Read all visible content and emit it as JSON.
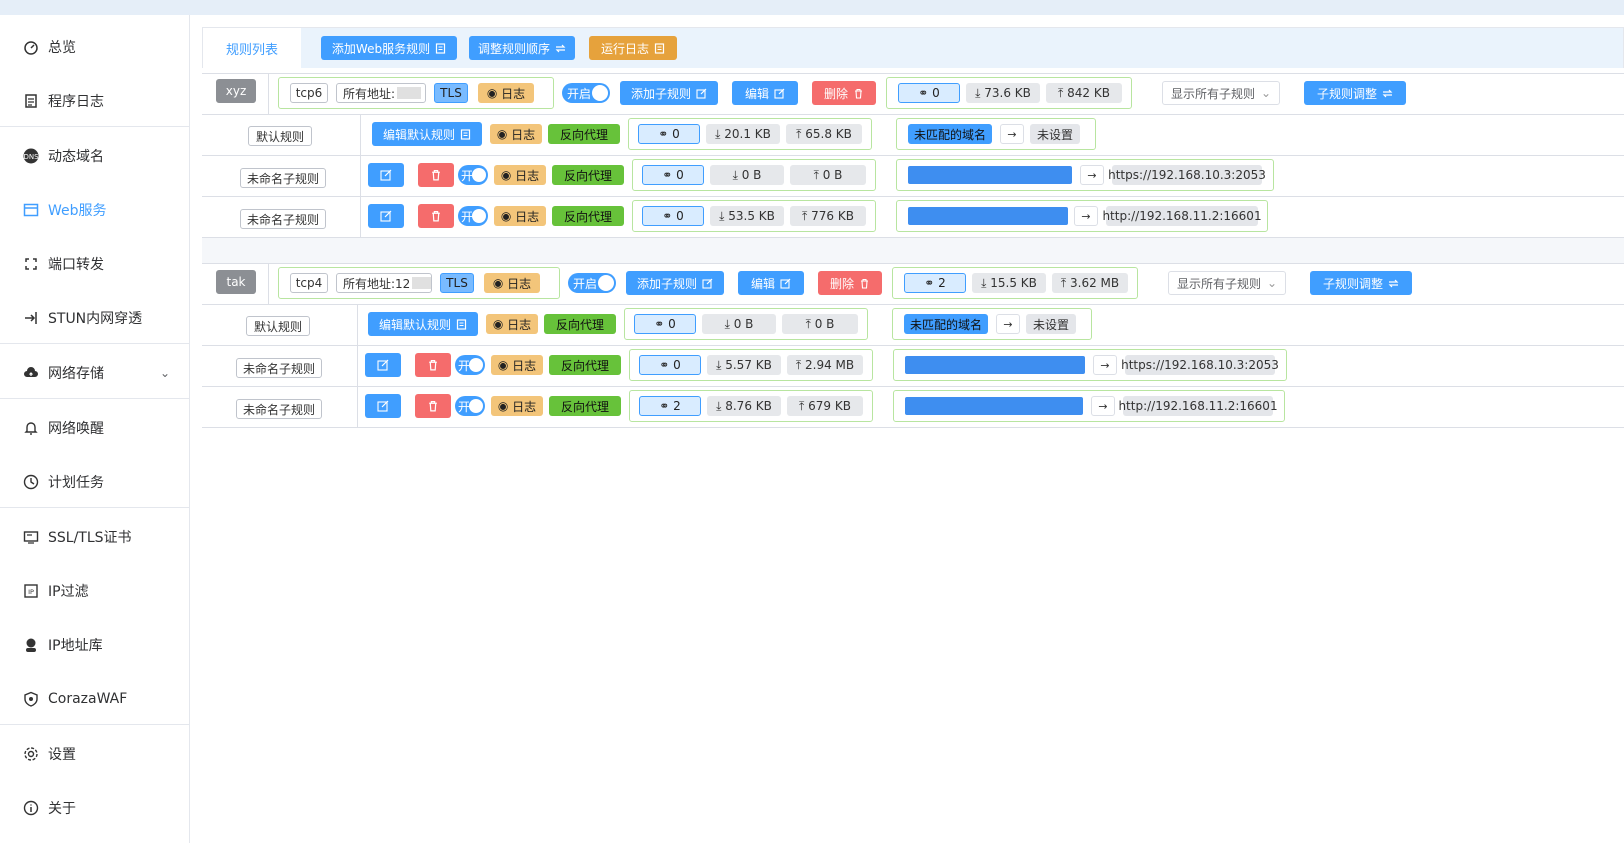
{
  "sidebar": {
    "items": [
      {
        "label": "总览",
        "icon": "dashboard-icon"
      },
      {
        "label": "程序日志",
        "icon": "log-icon"
      },
      {
        "label": "动态域名",
        "icon": "dns-icon"
      },
      {
        "label": "Web服务",
        "icon": "web-icon",
        "active": true
      },
      {
        "label": "端口转发",
        "icon": "port-forward-icon"
      },
      {
        "label": "STUN内网穿透",
        "icon": "stun-icon"
      },
      {
        "label": "网络存储",
        "icon": "cloud-icon",
        "expandable": true
      },
      {
        "label": "网络唤醒",
        "icon": "bell-icon"
      },
      {
        "label": "计划任务",
        "icon": "clock-icon"
      },
      {
        "label": "SSL/TLS证书",
        "icon": "certificate-icon"
      },
      {
        "label": "IP过滤",
        "icon": "ip-filter-icon"
      },
      {
        "label": "IP地址库",
        "icon": "ip-database-icon"
      },
      {
        "label": "CorazaWAF",
        "icon": "shield-icon"
      },
      {
        "label": "设置",
        "icon": "gear-icon"
      },
      {
        "label": "关于",
        "icon": "info-icon"
      }
    ]
  },
  "tabs": {
    "active": "规则列表",
    "add_web": "添加Web服务规则",
    "reorder": "调整规则顺序",
    "run_log": "运行日志"
  },
  "common": {
    "tls": "TLS",
    "log": "日志",
    "enabled": "开启",
    "add_sub": "添加子规则",
    "edit": "编辑",
    "delete": "删除",
    "show_all": "显示所有子规则",
    "sub_adjust": "子规则调整",
    "default_rule": "默认规则",
    "edit_default": "编辑默认规则",
    "proxy": "反向代理",
    "unmatched": "未匹配的域名",
    "unset": "未设置",
    "unnamed": "未命名子规则",
    "switch_on": "开",
    "arrow": "→"
  },
  "rules": [
    {
      "name": "xyz",
      "proto": "tcp6",
      "addr": "所有地址:",
      "conns": "0",
      "down": "73.6 KB",
      "up": "842 KB",
      "default": {
        "conns": "0",
        "down": "20.1 KB",
        "up": "65.8 KB"
      },
      "subs": [
        {
          "conns": "0",
          "down": "0 B",
          "up": "0 B",
          "target": "https://192.168.10.3:2053"
        },
        {
          "conns": "0",
          "down": "53.5 KB",
          "up": "776 KB",
          "target": "http://192.168.11.2:16601"
        }
      ]
    },
    {
      "name": "tak",
      "proto": "tcp4",
      "addr": "所有地址:12",
      "conns": "2",
      "down": "15.5 KB",
      "up": "3.62 MB",
      "default": {
        "conns": "0",
        "down": "0 B",
        "up": "0 B"
      },
      "subs": [
        {
          "conns": "0",
          "down": "5.57 KB",
          "up": "2.94 MB",
          "target": "https://192.168.10.3:2053"
        },
        {
          "conns": "2",
          "down": "8.76 KB",
          "up": "679 KB",
          "target": "http://192.168.11.2:16601"
        }
      ]
    }
  ],
  "colors": {
    "accent": "#409eff",
    "danger": "#f56c6c",
    "warning": "#e6a23c",
    "success": "#67c23a"
  }
}
